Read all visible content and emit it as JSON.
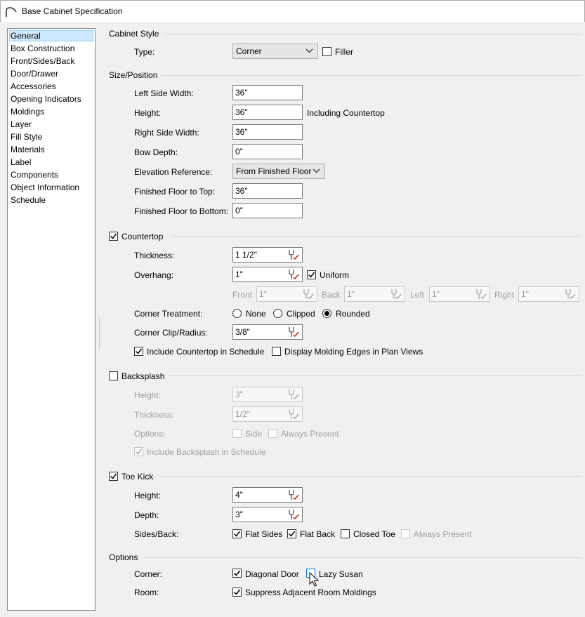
{
  "window": {
    "title": "Base Cabinet Specification"
  },
  "nav": {
    "items": [
      "General",
      "Box Construction",
      "Front/Sides/Back",
      "Door/Drawer",
      "Accessories",
      "Opening Indicators",
      "Moldings",
      "Layer",
      "Fill Style",
      "Materials",
      "Label",
      "Components",
      "Object Information",
      "Schedule"
    ],
    "selected": "General"
  },
  "cabinet_style": {
    "heading": "Cabinet Style",
    "type_label": "Type:",
    "type_value": "Corner",
    "filler_label": "Filler",
    "filler_checked": false
  },
  "size": {
    "heading": "Size/Position",
    "left_label": "Left Side Width:",
    "left_value": "36\"",
    "height_label": "Height:",
    "height_value": "36\"",
    "height_note": "Including Countertop",
    "right_label": "Right Side Width:",
    "right_value": "36\"",
    "bow_label": "Bow Depth:",
    "bow_value": "0\"",
    "elev_label": "Elevation Reference:",
    "elev_value": "From Finished Floor",
    "top_label": "Finished Floor to Top:",
    "top_value": "36\"",
    "bottom_label": "Finished Floor to Bottom:",
    "bottom_value": "0\""
  },
  "countertop": {
    "heading": "Countertop",
    "checked": true,
    "thickness_label": "Thickness:",
    "thickness_value": "1 1/2\"",
    "overhang_label": "Overhang:",
    "overhang_value": "1\"",
    "uniform_label": "Uniform",
    "uniform_checked": true,
    "front_label": "Front",
    "front_value": "1\"",
    "back_label": "Back",
    "back_value": "1\"",
    "left_label": "Left",
    "left_value": "1\"",
    "right_label": "Right",
    "right_value": "1\"",
    "corner_label": "Corner Treatment:",
    "opt_none": "None",
    "opt_clipped": "Clipped",
    "opt_rounded": "Rounded",
    "corner_selected": "Rounded",
    "clip_label": "Corner Clip/Radius:",
    "clip_value": "3/8\"",
    "schedule_label": "Include Countertop in Schedule",
    "schedule_checked": true,
    "molding_label": "Display Molding Edges in Plan Views",
    "molding_checked": false
  },
  "backsplash": {
    "heading": "Backsplash",
    "checked": false,
    "height_label": "Height:",
    "height_value": "3\"",
    "thickness_label": "Thickness:",
    "thickness_value": "1/2\"",
    "options_label": "Options:",
    "side_label": "Side",
    "always_label": "Always Present",
    "schedule_label": "Include Backsplash in Schedule",
    "schedule_checked": true
  },
  "toekick": {
    "heading": "Toe Kick",
    "checked": true,
    "height_label": "Height:",
    "height_value": "4\"",
    "depth_label": "Depth:",
    "depth_value": "3\"",
    "sides_label": "Sides/Back:",
    "flat_sides": "Flat Sides",
    "flat_back": "Flat Back",
    "closed_toe": "Closed Toe",
    "always_present": "Always Present"
  },
  "options": {
    "heading": "Options",
    "corner_label": "Corner:",
    "diagonal_label": "Diagonal Door",
    "diagonal_checked": true,
    "lazy_label": "Lazy Susan",
    "lazy_checked": false,
    "room_label": "Room:",
    "suppress_label": "Suppress Adjacent Room Moldings",
    "suppress_checked": true
  },
  "icons": {
    "dropdown": "chevron-down-icon",
    "wrench": "wrench-icon",
    "check": "check-icon",
    "cursor": "mouse-cursor-icon",
    "logo": "arch-logo-icon"
  }
}
